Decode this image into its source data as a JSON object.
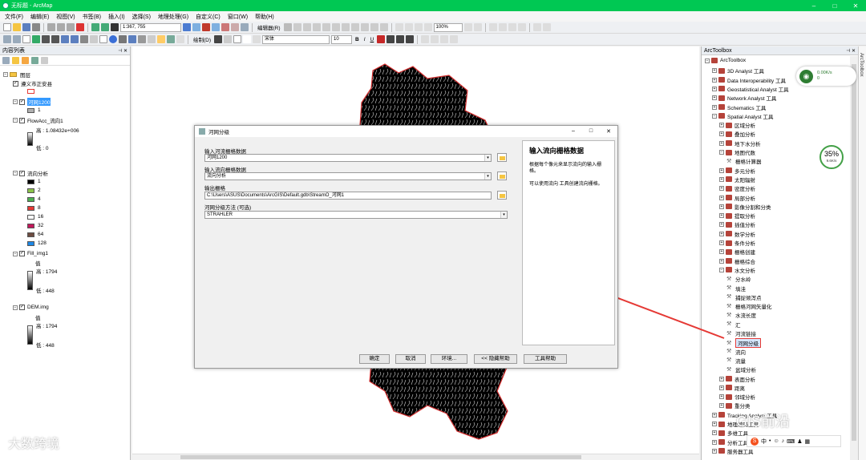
{
  "titlebar": {
    "title": "无标题 - ArcMap"
  },
  "menu": [
    "文件(F)",
    "编辑(E)",
    "视图(V)",
    "书签(B)",
    "插入(I)",
    "选择(S)",
    "地理处理(G)",
    "自定义(C)",
    "窗口(W)",
    "帮助(H)"
  ],
  "toolbar": {
    "scale": "1:367, 755",
    "editor_label": "编辑器(R)",
    "zoom_value": "100%",
    "draw_label": "绘制(D)",
    "font_name": "宋体",
    "font_size": "10",
    "bold": "B",
    "italic": "I",
    "underline": "U"
  },
  "toc": {
    "title": "内容列表",
    "root": "图层",
    "layers": [
      {
        "name": "遵义市正安县",
        "checked": true
      },
      {
        "name": "河网1200",
        "checked": true,
        "legend": [
          "1"
        ]
      },
      {
        "name": "FlowAcc_流向1",
        "checked": true,
        "high": "高 : 1.08432e+006",
        "low": "低 : 0"
      },
      {
        "name": "流向分析",
        "checked": true,
        "classes": [
          {
            "label": "1",
            "color": "#000000"
          },
          {
            "label": "2",
            "color": "#8bc34a"
          },
          {
            "label": "4",
            "color": "#4caf50"
          },
          {
            "label": "8",
            "color": "#e53935"
          },
          {
            "label": "16",
            "color": "#ffffff"
          },
          {
            "label": "32",
            "color": "#c2185b"
          },
          {
            "label": "64",
            "color": "#6d4c41"
          },
          {
            "label": "128",
            "color": "#1e88e5"
          }
        ]
      },
      {
        "name": "Fill_img1",
        "checked": true,
        "value": "值",
        "high": "高 : 1794",
        "low": "低 : 448"
      },
      {
        "name": "DEM.img",
        "checked": true,
        "value": "值",
        "high": "高 : 1794",
        "low": "低 : 448"
      }
    ]
  },
  "dialog": {
    "title": "河网分级",
    "param1_label": "输入河流栅格数据",
    "param1_value": "河网1200",
    "param2_label": "输入流向栅格数据",
    "param2_value": "流向分析",
    "param3_label": "输出栅格",
    "param3_value": "C:\\Users\\ASUS\\Documents\\ArcGIS\\Default.gdb\\StreamO_河网1",
    "param4_label": "河网分级方法 (可选)",
    "param4_value": "STRAHLER",
    "help_title": "输入流向栅格数据",
    "help_p1": "根据每个像元来显示流向的输入栅格。",
    "help_p2": "可以使用流向 工具创建流向栅格。",
    "buttons": {
      "ok": "确定",
      "cancel": "取消",
      "env": "环境...",
      "hide_help": "<< 隐藏帮助",
      "tool_help": "工具帮助"
    }
  },
  "arctoolbox": {
    "title": "ArcToolbox",
    "root": "ArcToolbox",
    "top_items": [
      "3D Analyst 工具",
      "Data Interoperability 工具",
      "Geostatistical Analyst 工具",
      "Network Analyst 工具",
      "Schematics 工具",
      "Spatial Analyst 工具"
    ],
    "spatial_children": [
      "区域分析",
      "叠加分析",
      "地下水分析",
      "地图代数",
      "多元分析",
      "太阳辐射",
      "密度分析",
      "局部分析",
      "影像分割和分类",
      "提取分析",
      "插值分析",
      "数学分析",
      "条件分析",
      "栅格创建",
      "栅格综合",
      "水文分析",
      "表面分析",
      "距离",
      "邻域分析",
      "重分类"
    ],
    "map_algebra_tool": "栅格计算器",
    "hydro_tools": [
      "分水岭",
      "填洼",
      "捕捉倾泻点",
      "栅格河网矢量化",
      "水流长度",
      "汇",
      "河流链接",
      "河网分级",
      "流向",
      "流量",
      "盆域分析"
    ],
    "bottom_items": [
      "Tracking Analyst 工具",
      "地理编码工具",
      "多维工具",
      "分析工具",
      "服务器工具"
    ],
    "selected_tool": "河网分级"
  },
  "net_widget": {
    "up": "0.00K/s",
    "down": "0",
    "percent": "35%",
    "rate": "9.6K/s"
  },
  "watermarks": {
    "left": "大数跨境",
    "right": "GIS前沿"
  },
  "ime": {
    "label": "中"
  },
  "side_tab": "ArcToolbox",
  "colors": {
    "titlebar": "#00c853",
    "arrow": "#e53935",
    "selection": "#3399ff"
  }
}
